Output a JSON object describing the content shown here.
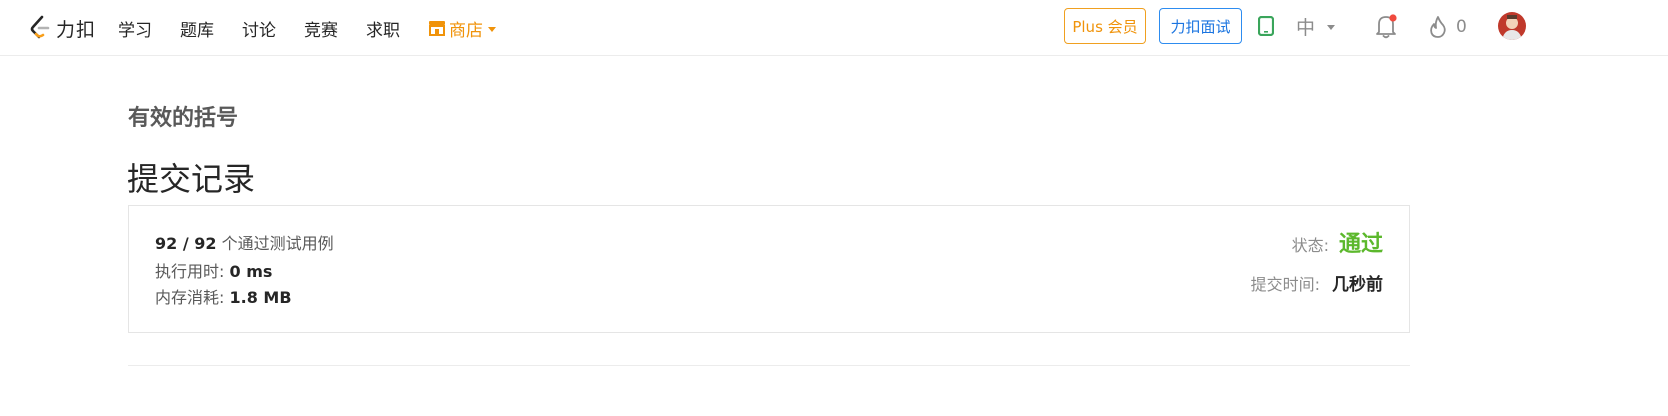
{
  "header": {
    "logo_text": "力扣",
    "nav": [
      {
        "label": "学习"
      },
      {
        "label": "题库"
      },
      {
        "label": "讨论"
      },
      {
        "label": "竞赛"
      },
      {
        "label": "求职"
      }
    ],
    "store_label": "商店",
    "plus_label": "Plus 会员",
    "interview_label": "力扣面试",
    "lang_label": "中",
    "streak_count": "0",
    "accent_orange": "#f0930a",
    "accent_blue": "#1a74e0"
  },
  "main": {
    "problem_title": "有效的括号",
    "page_title": "提交记录",
    "result": {
      "passed": "92 / 92",
      "passed_suffix": "个通过测试用例",
      "runtime_label": "执行用时:",
      "runtime_value": "0 ms",
      "memory_label": "内存消耗:",
      "memory_value": "1.8 MB",
      "status_label": "状态:",
      "status_value": "通过",
      "status_color": "#5cb82c",
      "submit_time_label": "提交时间:",
      "submit_time_value": "几秒前"
    }
  }
}
